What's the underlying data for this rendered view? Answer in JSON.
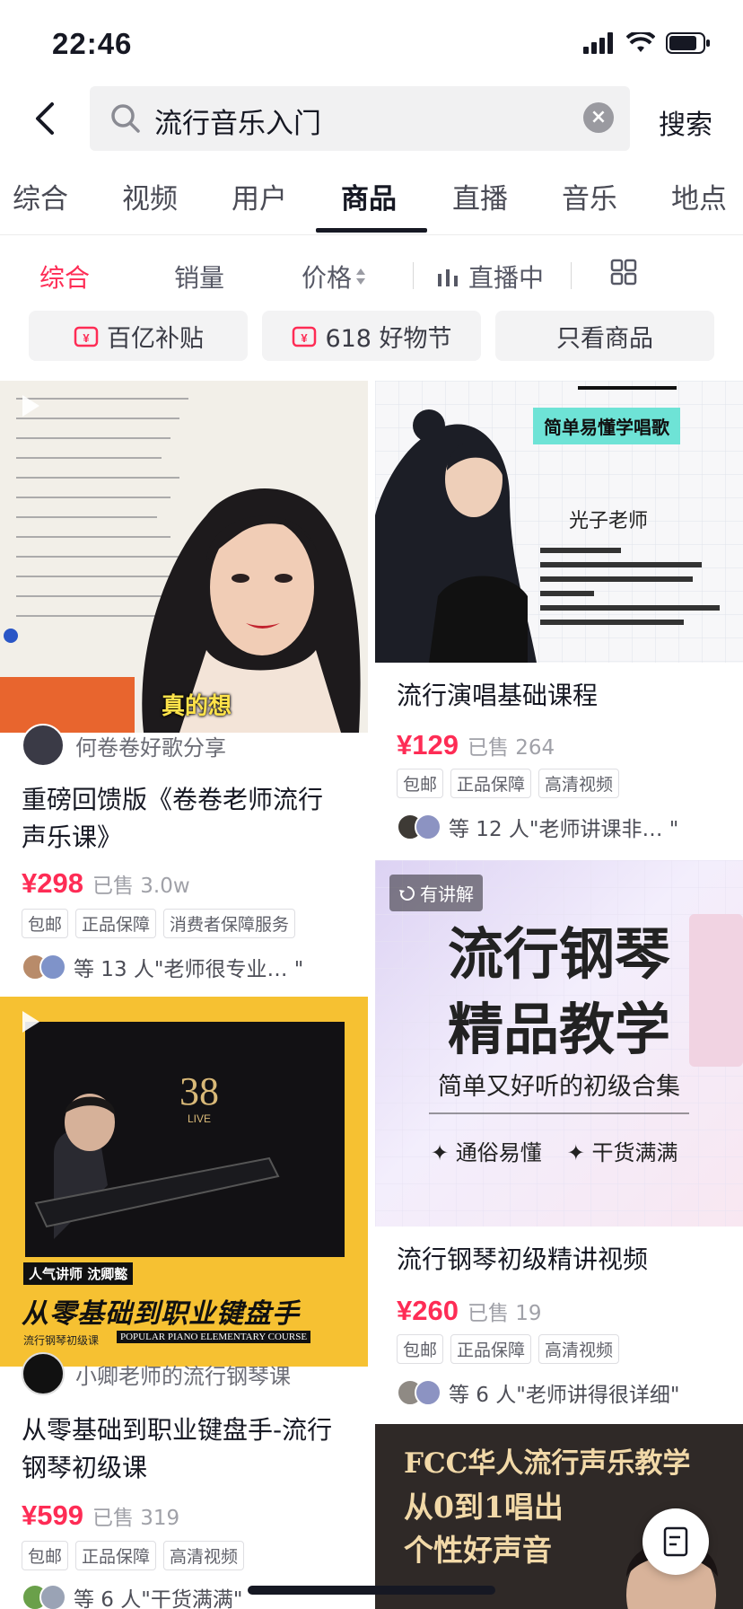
{
  "status": {
    "time": "22:46"
  },
  "search": {
    "query": "流行音乐入门",
    "button": "搜索"
  },
  "tabs": [
    {
      "label": "综合"
    },
    {
      "label": "视频"
    },
    {
      "label": "用户"
    },
    {
      "label": "商品"
    },
    {
      "label": "直播"
    },
    {
      "label": "音乐"
    },
    {
      "label": "地点"
    }
  ],
  "active_tab": "商品",
  "filters": {
    "all": "综合",
    "sales": "销量",
    "price": "价格",
    "live": "直播中"
  },
  "chips": [
    {
      "label": "百亿补贴"
    },
    {
      "label": "618 好物节"
    },
    {
      "label": "只看商品"
    }
  ],
  "products": [
    {
      "seller": "何卷卷好歌分享",
      "title": "重磅回馈版《卷卷老师流行声乐课》",
      "title_line1": "重磅回馈版《卷卷老师流行",
      "title_line2": "声乐课》",
      "price": "¥298",
      "sold": "已售 3.0w",
      "tags": [
        "包邮",
        "正品保障",
        "消费者保障服务"
      ],
      "review": "等 13 人\"老师很专业…  \"",
      "thumb_caption": "真的想"
    },
    {
      "title": "流行演唱基础课程",
      "price": "¥129",
      "sold": "已售 264",
      "tags": [
        "包邮",
        "正品保障",
        "高清视频"
      ],
      "review": "等 12 人\"老师讲课非…  \"",
      "thumb_banner": "简单易懂学唱歌",
      "thumb_name": "光子老师"
    },
    {
      "badge": "有讲解",
      "thumb_title1": "流行钢琴",
      "thumb_title2": "精品教学",
      "thumb_sub": "简单又好听的初级合集",
      "thumb_points": [
        "通俗易懂",
        "干货满满"
      ],
      "title": "流行钢琴初级精讲视频",
      "price": "¥260",
      "sold": "已售 19",
      "tags": [
        "包邮",
        "正品保障",
        "高清视频"
      ],
      "review": "等 6 人\"老师讲得很详细\""
    },
    {
      "seller": "小卿老师的流行钢琴课",
      "title_line1": "从零基础到职业键盘手-流行",
      "title_line2": "钢琴初级课",
      "price": "¥599",
      "sold": "已售 319",
      "tags": [
        "包邮",
        "正品保障",
        "高清视频"
      ],
      "review": "等 6 人\"干货满满\"",
      "thumb_label": "人气讲师 沈卿懿",
      "thumb_headline": "从零基础到职业键盘手",
      "thumb_sub": "流行钢琴初级课",
      "thumb_en": "POPULAR PIANO ELEMENTARY COURSE"
    },
    {
      "thumb_line1": "FCC华人流行声乐教学",
      "thumb_line2": "从0到1唱出",
      "thumb_line3": "个性好声音"
    }
  ],
  "colors": {
    "accent": "#fe2c55",
    "text": "#161823",
    "muted": "#a0a1a8"
  }
}
